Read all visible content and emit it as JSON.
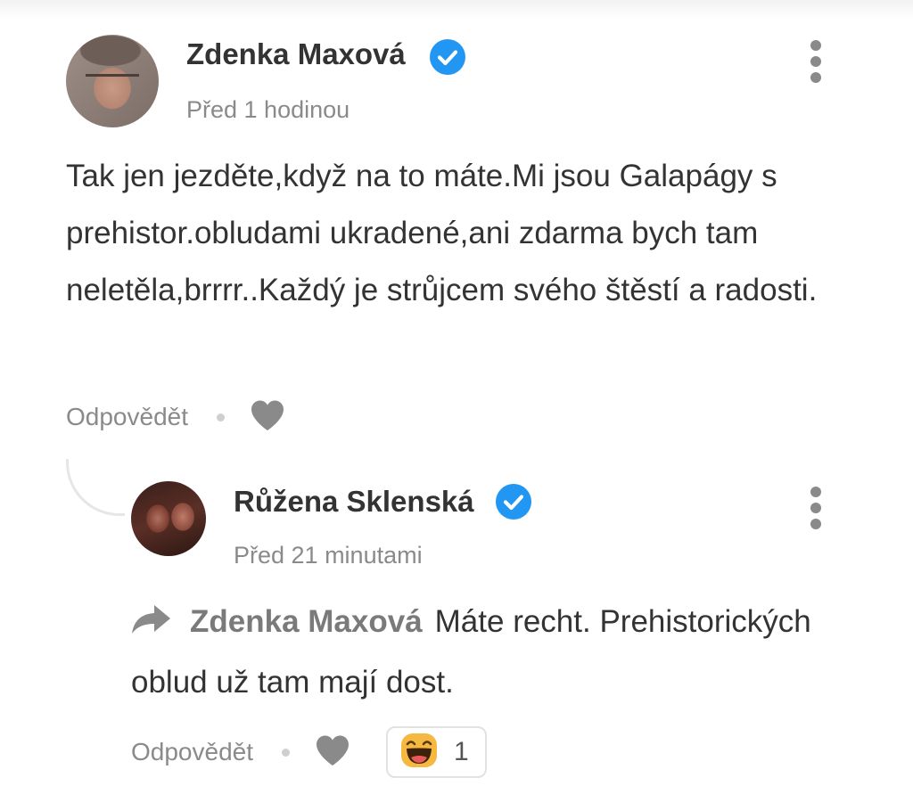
{
  "comments": [
    {
      "author": "Zdenka Maxová",
      "timestamp": "Před 1 hodinou",
      "text": "Tak jen jezděte,když na to máte.Mi jsou Galapágy s prehistor.obludami ukradené,ani zdarma bych tam neletěla,brrrr..Každý je strůjcem svého štěstí a radosti.",
      "reply_label": "Odpovědět"
    }
  ],
  "replies": [
    {
      "author": "Růžena Sklenská",
      "timestamp": "Před 21 minutami",
      "mention": "Zdenka Maxová",
      "text": "Máte recht. Prehistorických oblud už tam mají dost.",
      "reply_label": "Odpovědět",
      "reaction": {
        "icon": "laughing-face-emoji",
        "count": "1"
      }
    }
  ],
  "icons": {
    "verified": "verified-badge-icon",
    "more": "more-options-icon",
    "like": "heart-icon",
    "reply_arrow": "reply-arrow-icon"
  },
  "colors": {
    "verified": "#2196f3",
    "text": "#333333",
    "muted": "#8a8a8a",
    "icon": "#8a8a8a",
    "emoji": "#f5b942"
  }
}
